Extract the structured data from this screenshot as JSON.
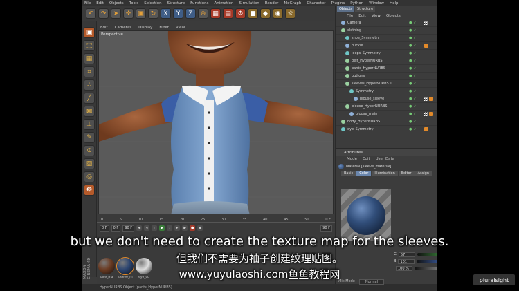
{
  "menu": [
    "File",
    "Edit",
    "Objects",
    "Tools",
    "Selection",
    "Structure",
    "Functions",
    "Animation",
    "Simulation",
    "Render",
    "MoGraph",
    "Character",
    "Plugins",
    "Python",
    "Window",
    "Help"
  ],
  "toolbar_icons": [
    "undo-icon",
    "redo-icon",
    "select-icon",
    "move-icon",
    "scale-icon",
    "rotate-icon",
    "x-axis-icon",
    "y-axis-icon",
    "z-axis-icon",
    "coordinate-icon",
    "render-view-icon",
    "render-picture-icon",
    "render-settings-icon",
    "cube-icon",
    "nurbs-icon",
    "array-icon",
    "environment-icon"
  ],
  "viewport": {
    "menu": [
      "Edit",
      "Cameras",
      "Display",
      "Filter",
      "View"
    ],
    "label": "Perspective"
  },
  "timeline": {
    "ticks": [
      "0",
      "5",
      "10",
      "15",
      "20",
      "25",
      "30",
      "35",
      "40",
      "45",
      "50"
    ],
    "end_frame": "0 F",
    "start_field": "0 F",
    "current_field": "0 F",
    "end_field": "90 F",
    "max_field": "90 F"
  },
  "materials": [
    {
      "label": "face_ma",
      "color": "#6b3b22"
    },
    {
      "label": "sleeve_m",
      "color": "#2b4470"
    },
    {
      "label": "eye_cu",
      "color": "#dedede"
    }
  ],
  "status_bar": "HyperNURBS Object [pants_HyperNURBS]",
  "c4d_logo": "MAXON CINEMA 4D",
  "objects_panel": {
    "tabs": [
      "Objects",
      "Structure"
    ],
    "menu": [
      "File",
      "Edit",
      "View",
      "Objects"
    ],
    "rows": [
      {
        "name": "Camera",
        "indent": 1,
        "color": "#8fb0d8",
        "tags": [
          "chk"
        ]
      },
      {
        "name": "clothing",
        "indent": 1,
        "color": "#9ad1a0",
        "tags": []
      },
      {
        "name": "shoe_Symmetry",
        "indent": 2,
        "color": "#6fc6c6",
        "tags": []
      },
      {
        "name": "buckle",
        "indent": 2,
        "color": "#8fb0d8",
        "tags": [
          "ora"
        ]
      },
      {
        "name": "loops_Symmetry",
        "indent": 2,
        "color": "#6fc6c6",
        "tags": []
      },
      {
        "name": "belt_HyperNURBS",
        "indent": 2,
        "color": "#9ad1a0",
        "tags": []
      },
      {
        "name": "pants_HyperNURBS",
        "indent": 2,
        "color": "#9ad1a0",
        "tags": []
      },
      {
        "name": "buttons",
        "indent": 2,
        "color": "#9ad1a0",
        "tags": []
      },
      {
        "name": "sleeves_HyperNURBS.1",
        "indent": 2,
        "color": "#9ad1a0",
        "tags": []
      },
      {
        "name": "Symmetry",
        "indent": 3,
        "color": "#6fc6c6",
        "tags": []
      },
      {
        "name": "blouse_sleeve",
        "indent": 4,
        "color": "#8fb0d8",
        "tags": [
          "chk",
          "ora"
        ]
      },
      {
        "name": "blouse_HyperNURBS",
        "indent": 2,
        "color": "#9ad1a0",
        "tags": []
      },
      {
        "name": "blouse_main",
        "indent": 3,
        "color": "#8fb0d8",
        "tags": [
          "chk",
          "ora"
        ]
      },
      {
        "name": "body_HyperNURBS",
        "indent": 1,
        "color": "#9ad1a0",
        "tags": []
      },
      {
        "name": "eye_Symmetry",
        "indent": 1,
        "color": "#6fc6c6",
        "tags": [
          "ora"
        ]
      }
    ]
  },
  "attributes_panel": {
    "title": "Attributes",
    "menu": [
      "Mode",
      "Edit",
      "User Data"
    ],
    "material_name": "Material [sleeve_material]",
    "tabs": [
      "Basic",
      "Color",
      "Illumination",
      "Editor",
      "Assign"
    ],
    "active_tab": "Color",
    "color_rows": [
      {
        "label": "G",
        "value": "57",
        "bar": "#3c8a3c"
      },
      {
        "label": "B",
        "value": "101",
        "bar": "#3c5fa8"
      },
      {
        "label": "",
        "value": "100 %",
        "bar": "#888888"
      }
    ],
    "mix_mode_label": "Mix Mode",
    "mix_mode_value": "Normal"
  },
  "subtitles": {
    "line1": "but we don't need to create the texture map for the sleeves.",
    "line2": "但我们不需要为袖子创建纹理贴图。",
    "line3": "www.yuyulaoshi.com鱼鱼教程网"
  },
  "watermark": "pluralsight"
}
